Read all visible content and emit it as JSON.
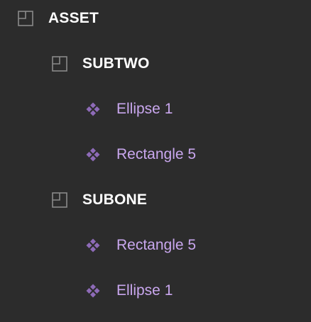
{
  "layers": {
    "root": {
      "label": "ASSET",
      "icon": "frame-icon"
    },
    "subtwo": {
      "label": "SUBTWO",
      "icon": "frame-icon",
      "children": [
        {
          "label": "Ellipse 1",
          "icon": "component-icon"
        },
        {
          "label": "Rectangle 5",
          "icon": "component-icon"
        }
      ]
    },
    "subone": {
      "label": "SUBONE",
      "icon": "frame-icon",
      "children": [
        {
          "label": "Rectangle 5",
          "icon": "component-icon"
        },
        {
          "label": "Ellipse 1",
          "icon": "component-icon"
        }
      ]
    }
  },
  "colors": {
    "background": "#2c2c2c",
    "frame_label": "#ffffff",
    "component_label": "#c9a7ee",
    "component_icon": "#8e6bb8",
    "frame_icon_stroke": "#8a8a8a"
  }
}
